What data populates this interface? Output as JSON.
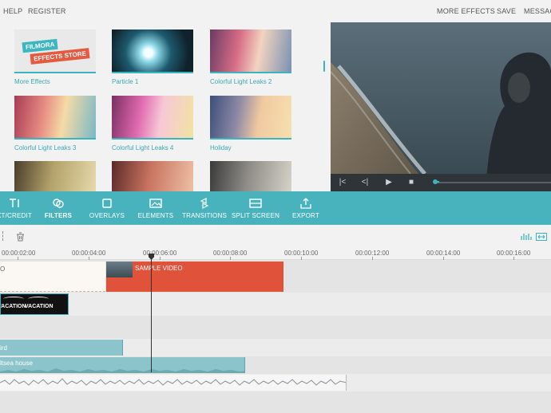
{
  "menu": {
    "help": "HELP",
    "register": "REGISTER",
    "more_effects": "MORE EFFECTS",
    "save": "SAVE",
    "messages": "MESSAG"
  },
  "library": {
    "items": [
      {
        "caption": "More Effects",
        "badge_line1": "FILMORA",
        "badge_line2": "EFFECTS STORE"
      },
      {
        "caption": "Particle 1"
      },
      {
        "caption": "Colorful Light Leaks 2"
      },
      {
        "caption": "Colorful Light Leaks 3"
      },
      {
        "caption": "Colorful Light Leaks 4"
      },
      {
        "caption": "Holiday"
      }
    ]
  },
  "toolbar": {
    "items": [
      {
        "label": "XT/CREDIT",
        "icon": "text-icon"
      },
      {
        "label": "FILTERS",
        "icon": "filters-icon",
        "active": true
      },
      {
        "label": "OVERLAYS",
        "icon": "overlays-icon"
      },
      {
        "label": "ELEMENTS",
        "icon": "elements-icon"
      },
      {
        "label": "TRANSITIONS",
        "icon": "transitions-icon"
      },
      {
        "label": "SPLIT SCREEN",
        "icon": "split-screen-icon"
      },
      {
        "label": "EXPORT",
        "icon": "export-icon"
      }
    ]
  },
  "timeline": {
    "ticks": [
      "00:00:02:00",
      "00:00:04:00",
      "00:00:06:00",
      "00:00:08:00",
      "00:00:10:00",
      "00:00:12:00",
      "00:00:14:00",
      "00:00:16:00"
    ],
    "video_clip_label": "SAMPLE VIDEO",
    "title_clip_text": "VACATION",
    "audio_clip_1": "ird",
    "audio_clip_2": "ltsea house"
  },
  "colors": {
    "accent": "#49b3bd",
    "video_clip": "#e0523a",
    "audio_clip": "#8cc4cb"
  }
}
